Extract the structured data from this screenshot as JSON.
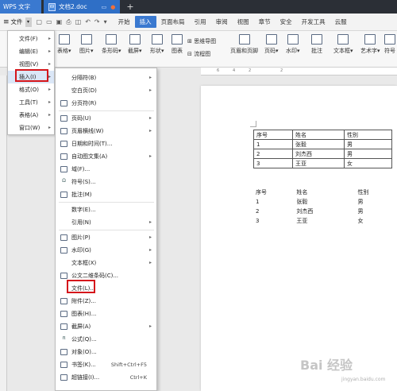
{
  "titlebar": {
    "app_tab": "WPS 文字",
    "doc_tab": "文档2.doc"
  },
  "tabrow": {
    "file_label": "文件",
    "tabs": [
      "开始",
      "插入",
      "页面布局",
      "引用",
      "审阅",
      "视图",
      "章节",
      "安全",
      "开发工具",
      "云服"
    ],
    "active_tab": "插入"
  },
  "toolbar": {
    "table": "表格",
    "picture": "图片",
    "barcode": "条形码",
    "screenshot": "截屏",
    "shape": "形状",
    "chart": "图表",
    "mindmap": "思维导图",
    "flowchart": "流程图",
    "header_footer": "页眉和页脚",
    "page_number": "页码",
    "watermark": "水印",
    "comment": "批注",
    "textbox": "文本框",
    "wordart": "艺术字",
    "symbol": "符号"
  },
  "file_menu": {
    "items": [
      {
        "label": "文件(F)"
      },
      {
        "label": "编辑(E)"
      },
      {
        "label": "视图(V)"
      },
      {
        "label": "插入(I)"
      },
      {
        "label": "格式(O)"
      },
      {
        "label": "工具(T)"
      },
      {
        "label": "表格(A)"
      },
      {
        "label": "窗口(W)"
      }
    ]
  },
  "insert_menu": {
    "items": [
      {
        "label": "分隔符(B)"
      },
      {
        "label": "空白页(D)"
      },
      {
        "label": "分页符(R)"
      },
      {
        "label": "页码(U)"
      },
      {
        "label": "页眉横线(W)"
      },
      {
        "label": "日期和时间(T)..."
      },
      {
        "label": "自动图文集(A)"
      },
      {
        "label": "域(F)..."
      },
      {
        "label": "符号(S)..."
      },
      {
        "label": "批注(M)"
      },
      {
        "label": "数字(E)..."
      },
      {
        "label": "引用(N)"
      },
      {
        "label": "图片(P)"
      },
      {
        "label": "水印(G)"
      },
      {
        "label": "文本框(X)"
      },
      {
        "label": "公文二维条码(C)..."
      },
      {
        "label": "文件(L)..."
      },
      {
        "label": "附件(Z)..."
      },
      {
        "label": "图表(H)..."
      },
      {
        "label": "截屏(A)"
      },
      {
        "label": "公式(Q)..."
      },
      {
        "label": "对象(O)..."
      },
      {
        "label": "书签(K)...",
        "shortcut": "Shift+Ctrl+F5"
      },
      {
        "label": "超链接(I)...",
        "shortcut": "Ctrl+K"
      }
    ]
  },
  "document": {
    "ruler_marks": [
      "6",
      "4",
      "2",
      "2"
    ],
    "table": {
      "rows": [
        [
          "序号",
          "姓名",
          "性别"
        ],
        [
          "1",
          "张毅",
          "男"
        ],
        [
          "2",
          "刘杰西",
          "男"
        ],
        [
          "3",
          "王亚",
          "女"
        ]
      ]
    },
    "plain_table": {
      "rows": [
        [
          "序号",
          "姓名",
          "性别"
        ],
        [
          "1",
          "张毅",
          "男"
        ],
        [
          "2",
          "刘杰西",
          "男"
        ],
        [
          "3",
          "王亚",
          "女"
        ]
      ]
    }
  },
  "watermark": {
    "brand": "Bai 经验",
    "sub": "jingyan.baidu.com"
  },
  "colors": {
    "accent": "#3a79d0",
    "highlight_red": "#d5161b",
    "menu_hover": "#dbe7f7"
  }
}
